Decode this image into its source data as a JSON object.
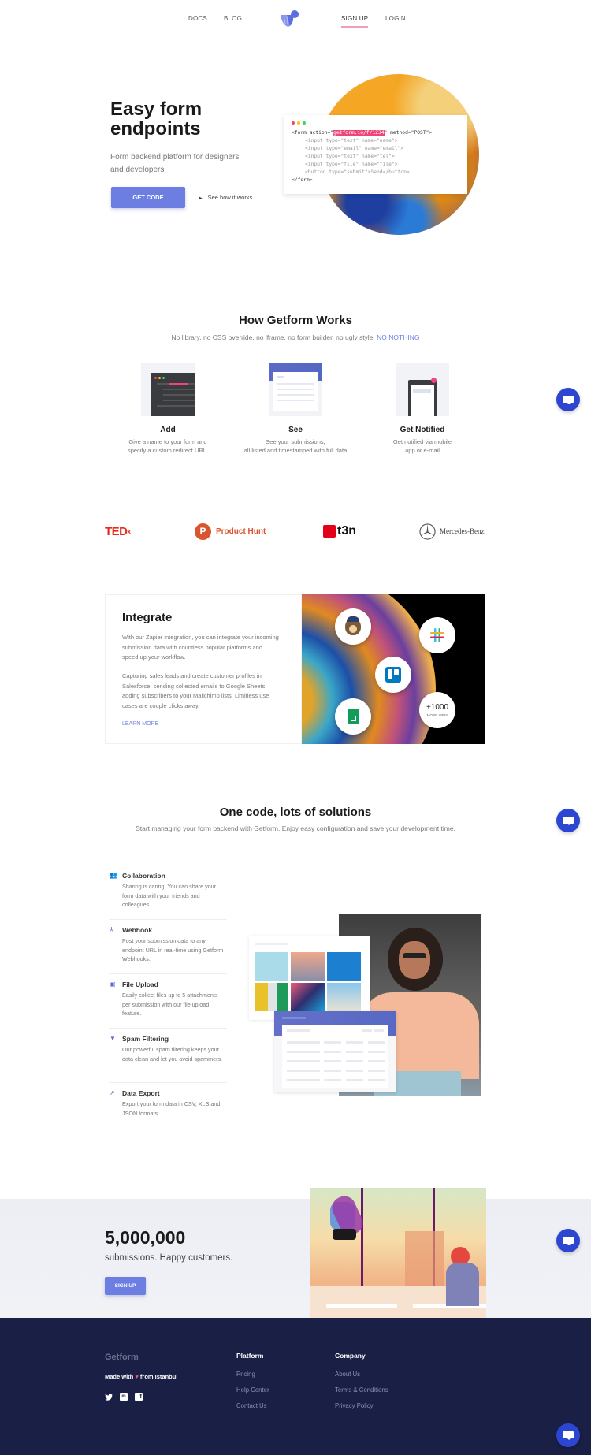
{
  "nav": {
    "docs": "DOCS",
    "blog": "BLOG",
    "signup": "SIGN UP",
    "login": "LOGIN",
    "logo_icon": "bird-logo-icon"
  },
  "hero": {
    "title_line1": "Easy form",
    "title_line2": "endpoints",
    "subtitle": "Form backend platform for designers and developers",
    "cta": "GET CODE",
    "video_link": "See how it works",
    "code": {
      "line1_pre": "<form action=\"",
      "line1_hl": "getform.io/f/1234",
      "line1_post": "\" method=\"POST\">",
      "line2": "<input type=\"text\" name=\"name\">",
      "line3": "<input type=\"email\" name=\"email\">",
      "line4": "<input type=\"text\" name=\"tel\">",
      "line5": "<input type=\"file\" name=\"file\">",
      "line6": "<button type=\"submit\">Send</button>",
      "line7": "</form>"
    }
  },
  "how": {
    "title": "How Getform Works",
    "subtitle": "No library, no CSS override, no iframe, no form builder, no ugly style.",
    "subtitle_accent": "NO NOTHING",
    "steps": [
      {
        "title": "Add",
        "desc_line1": "Give a name to your form and",
        "desc_line2": "specify a custom redirect URL."
      },
      {
        "title": "See",
        "desc_line1": "See your submissions,",
        "desc_line2": "all listed and timestamped with full data"
      },
      {
        "title": "Get Notified",
        "desc_line1": "Get notified via mobile",
        "desc_line2": "app or e-mail"
      }
    ]
  },
  "brands": {
    "tedx": "TED",
    "tedx_sup": "x",
    "producthunt": "Product Hunt",
    "producthunt_letter": "P",
    "t3n": "t3n",
    "mercedes": "Mercedes-Benz"
  },
  "integrate": {
    "title": "Integrate",
    "p1": "With our Zapier integration, you can integrate your incoming submission data with countless popular platforms and speed up your workflow.",
    "p2": "Capturing sales leads and create customer profiles in Salesforce, sending collected emails to Google Sheets, adding subscribers to your Mailchimp lists. Limitless use cases are couple clicks away.",
    "link": "LEARN MORE",
    "apps": [
      "mailchimp-icon",
      "slack-icon",
      "trello-icon",
      "google-sheets-icon"
    ],
    "more_count": "+1000",
    "more_label": "MORE APPS"
  },
  "solutions": {
    "title": "One code, lots of solutions",
    "subtitle": "Start managing your form backend with Getform. Enjoy easy configuration and save your development time.",
    "features": [
      {
        "title": "Collaboration",
        "desc": "Sharing is caring. You can share your form data with your friends and colleagues.",
        "icon": "users-icon"
      },
      {
        "title": "Webhook",
        "desc": "Post your submission data to any endpoint URL in real-time using Getform Webhooks.",
        "icon": "webhook-icon"
      },
      {
        "title": "File Upload",
        "desc": "Easily collect files up to 5 attachments per submission with our file upload feature.",
        "icon": "upload-icon"
      },
      {
        "title": "Spam Filtering",
        "desc": "Our powerful spam filtering keeps your data clean and let you avoid spammers.",
        "icon": "filter-icon"
      },
      {
        "title": "Data Export",
        "desc": "Export your form data in CSV, XLS and JSON formats.",
        "icon": "export-icon"
      }
    ]
  },
  "stats": {
    "number": "5,000,000",
    "label": "submissions. Happy customers.",
    "cta": "SIGN UP"
  },
  "footer": {
    "brand": "Getform",
    "made_pre": "Made with",
    "made_heart": "♥",
    "made_post": "from Istanbul",
    "platform_title": "Platform",
    "platform_links": [
      "Pricing",
      "Help Center",
      "Contact Us"
    ],
    "company_title": "Company",
    "company_links": [
      "About Us",
      "Terms & Conditions",
      "Privacy Policy"
    ],
    "social": {
      "twitter": "t",
      "linkedin": "in",
      "facebook": "f"
    }
  },
  "colors": {
    "accent": "#6d7ee3",
    "highlight": "#f0457a",
    "footer_bg": "#1a1f45",
    "chat": "#2d46d2"
  }
}
